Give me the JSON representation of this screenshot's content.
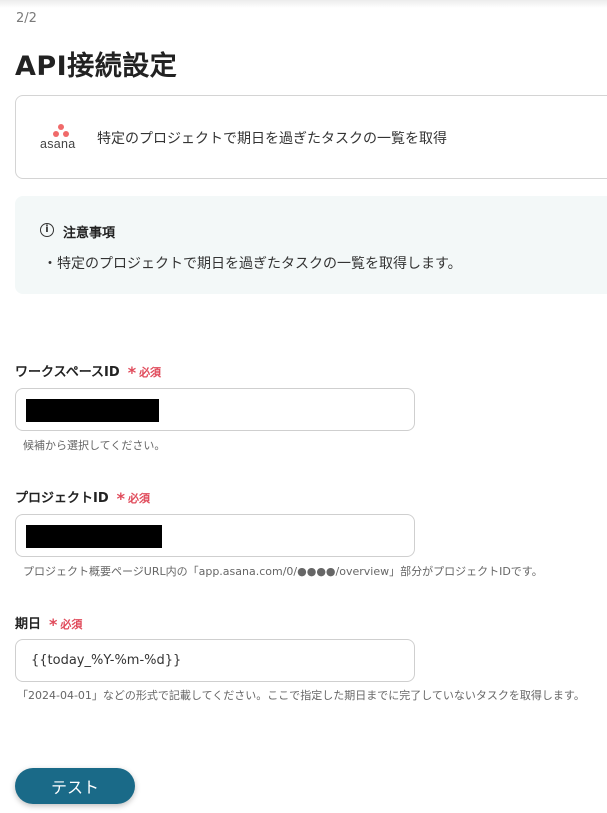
{
  "header": {
    "step": "2/2",
    "title": "API接続設定"
  },
  "app_card": {
    "logo_text": "asana",
    "logo_icon": "asana-logo",
    "action": "特定のプロジェクトで期日を過ぎたタスクの一覧を取得"
  },
  "notice": {
    "icon": "info-icon",
    "icon_glyph": "i",
    "title": "注意事項",
    "body": "・特定のプロジェクトで期日を過ぎたタスクの一覧を取得します。"
  },
  "fields": {
    "workspace": {
      "label": "ワークスペースID",
      "required_mark": "*",
      "required_text": "必須",
      "value_redacted": true,
      "hint": "候補から選択してください。"
    },
    "project": {
      "label": "プロジェクトID",
      "required_mark": "*",
      "required_text": "必須",
      "value_redacted": true,
      "hint": "プロジェクト概要ページURL内の「app.asana.com/0/●●●●/overview」部分がプロジェクトIDです。"
    },
    "due_date": {
      "label": "期日",
      "required_mark": "*",
      "required_text": "必須",
      "value": "{{today_%Y-%m-%d}}",
      "hint": "「2024-04-01」などの形式で記載してください。ここで指定した期日までに完了していないタスクを取得します。"
    }
  },
  "actions": {
    "test_label": "テスト"
  },
  "colors": {
    "accent": "#1a6a88",
    "required": "#e04a5a",
    "notice_bg": "#f3f8f8",
    "asana_brand": "#f06a6a"
  }
}
